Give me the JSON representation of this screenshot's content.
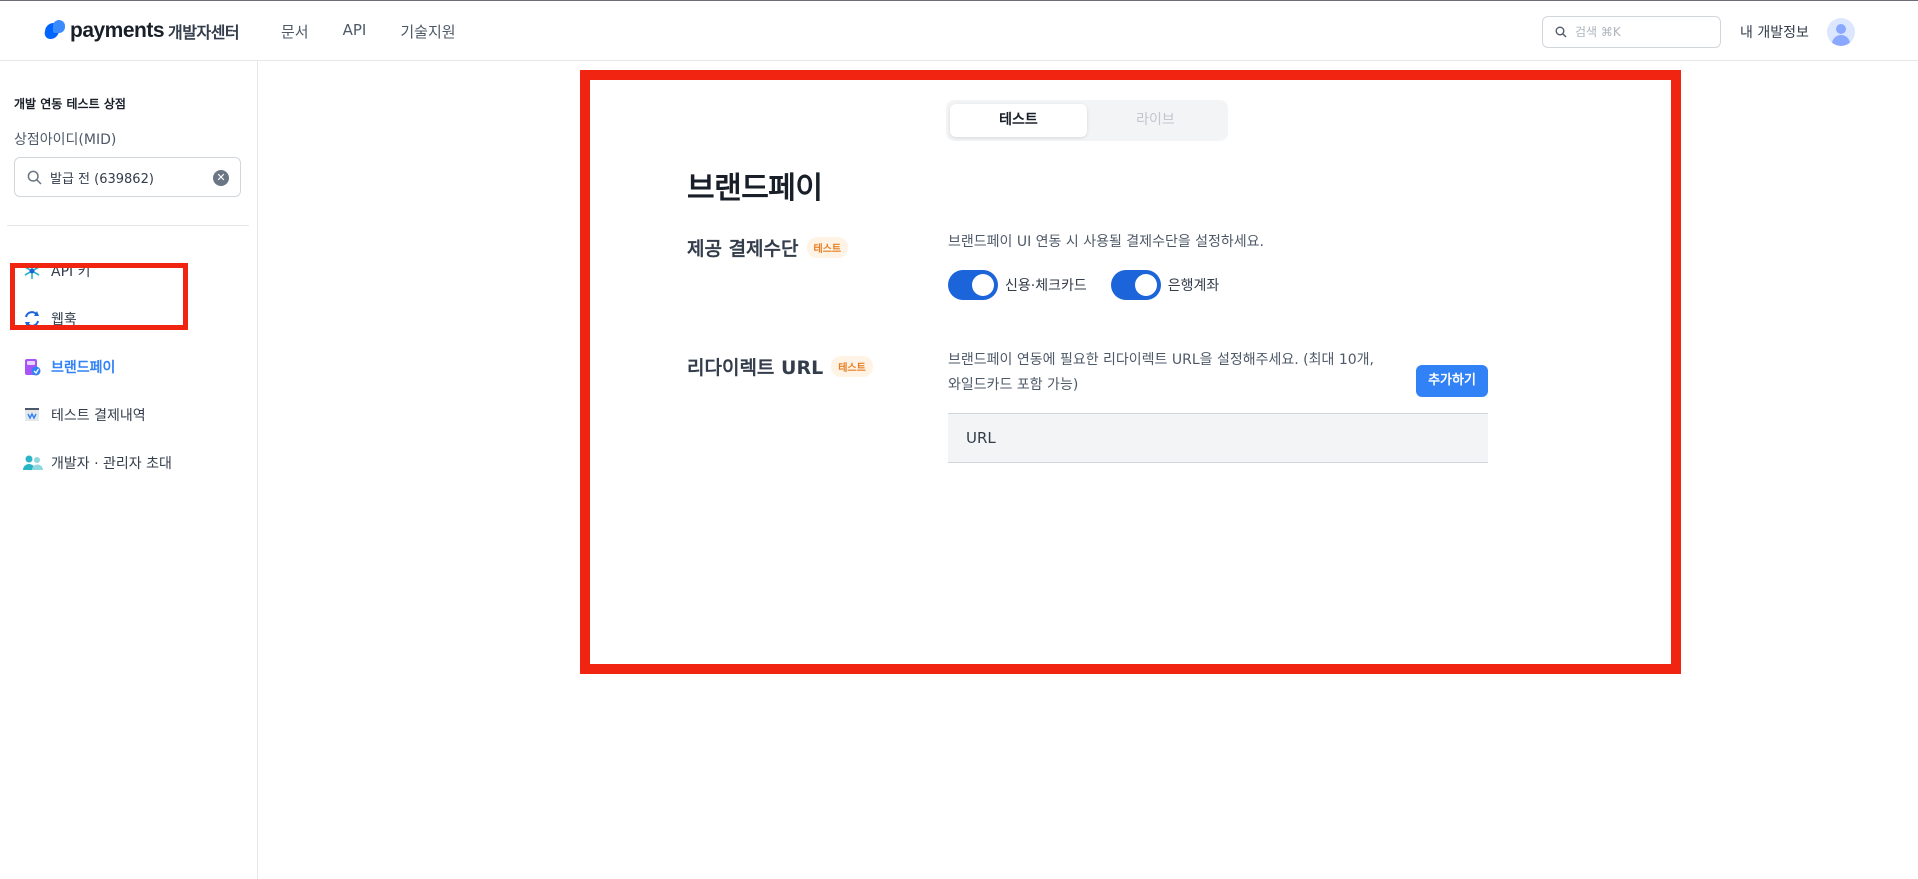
{
  "header": {
    "logo_text": "payments",
    "logo_sub": "개발자센터",
    "nav": [
      {
        "label": "문서"
      },
      {
        "label": "API"
      },
      {
        "label": "기술지원"
      }
    ],
    "search_placeholder": "검색 ⌘K",
    "my_info": "내 개발정보",
    "icons": {
      "search": "search-icon",
      "avatar": "user-avatar-icon"
    }
  },
  "sidebar": {
    "shop_name": "개발 연동 테스트 상점",
    "mid_label": "상점아이디(MID)",
    "mid_value": "발급 전 (639862)",
    "menu": [
      {
        "label": "API 키",
        "icon": "key-icon",
        "active": false
      },
      {
        "label": "웹훅",
        "icon": "webhook-icon",
        "active": false
      },
      {
        "label": "브랜드페이",
        "icon": "brandpay-icon",
        "active": true
      },
      {
        "label": "테스트 결제내역",
        "icon": "receipt-icon",
        "active": false
      },
      {
        "label": "개발자 · 관리자 초대",
        "icon": "people-icon",
        "active": false
      }
    ]
  },
  "main": {
    "env_tabs": [
      {
        "label": "테스트",
        "selected": true
      },
      {
        "label": "라이브",
        "selected": false
      }
    ],
    "title": "브랜드페이",
    "payment_section": {
      "label": "제공 결제수단",
      "badge": "테스트",
      "description": "브랜드페이 UI 연동 시 사용될 결제수단을 설정하세요.",
      "toggles": [
        {
          "label": "신용·체크카드",
          "on": true
        },
        {
          "label": "은행계좌",
          "on": true
        }
      ]
    },
    "redirect_section": {
      "label": "리다이렉트 URL",
      "badge": "테스트",
      "description_line1": "브랜드페이 연동에 필요한 리다이렉트 URL을 설정해주세요. (최대 10개,",
      "description_line2": "와일드카드 포함 가능)",
      "add_button": "추가하기",
      "table_header": "URL"
    }
  },
  "colors": {
    "accent": "#3182f6",
    "toggle_on": "#1b64da",
    "highlight": "#f02410",
    "badge_text": "#e67e22"
  }
}
